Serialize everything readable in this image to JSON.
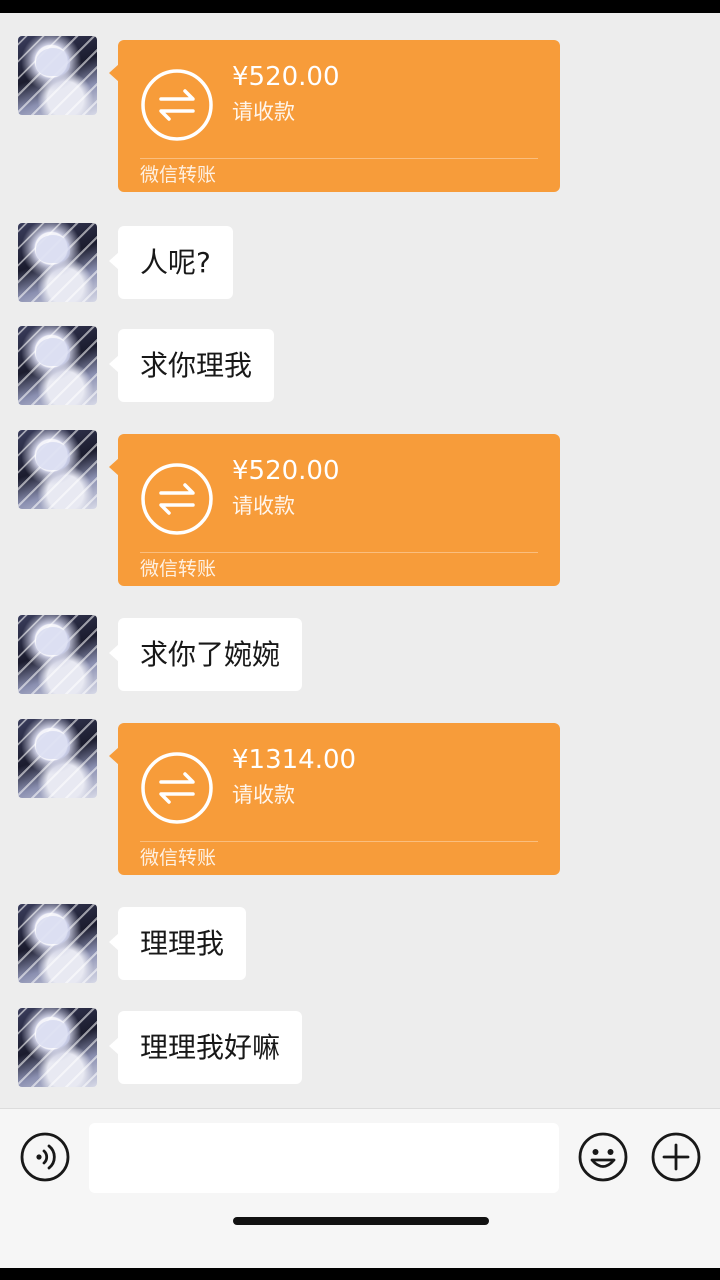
{
  "messages": [
    {
      "type": "transfer",
      "amount": "¥520.00",
      "note": "请收款",
      "brand": "微信转账"
    },
    {
      "type": "text",
      "text": "人呢?"
    },
    {
      "type": "text",
      "text": "求你理我"
    },
    {
      "type": "transfer",
      "amount": "¥520.00",
      "note": "请收款",
      "brand": "微信转账"
    },
    {
      "type": "text",
      "text": "求你了婉婉"
    },
    {
      "type": "transfer",
      "amount": "¥1314.00",
      "note": "请收款",
      "brand": "微信转账"
    },
    {
      "type": "text",
      "text": "理理我"
    },
    {
      "type": "text",
      "text": "理理我好嘛"
    }
  ],
  "input_bar": {
    "voice_icon": "voice-icon",
    "emoji_icon": "emoji-icon",
    "plus_icon": "plus-icon",
    "input_value": ""
  },
  "colors": {
    "background": "#ededed",
    "transfer": "#f79c3a",
    "bubble": "#ffffff"
  }
}
